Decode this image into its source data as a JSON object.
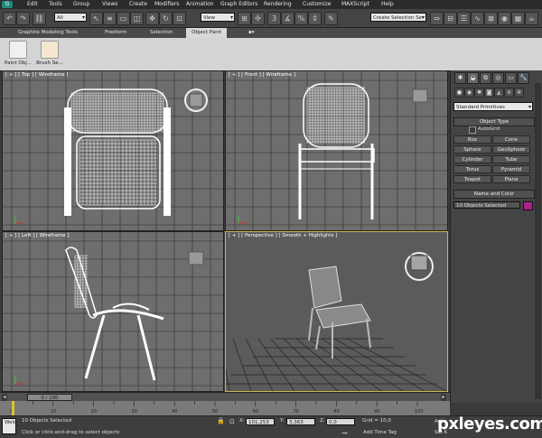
{
  "menu": [
    "Edit",
    "Tools",
    "Group",
    "Views",
    "Create",
    "Modifiers",
    "Animation",
    "Graph Editors",
    "Rendering",
    "Customize",
    "MAXScript",
    "Help"
  ],
  "toolbar": {
    "filter_value": "All",
    "view_value": "View",
    "selection_set_value": "Create Selection Se"
  },
  "ribbon": {
    "tabs": [
      "Graphite Modeling Tools",
      "Freeform",
      "Selection",
      "Object Paint"
    ],
    "active_tab": "Object Paint",
    "buttons": [
      "Paint Obj...",
      "Brush Se..."
    ]
  },
  "viewports": {
    "top": "[ + ] [ Top ] [ Wireframe ]",
    "front": "[ + ] [ Front ] [ Wireframe ]",
    "left": "[ + ] [ Left ] [ Wireframe ]",
    "perspective": "[ + ] [ Perspective ] [ Smooth + Highlights ]"
  },
  "command_panel": {
    "category": "Standard Primitives",
    "object_type_title": "Object Type",
    "autogrid_label": "AutoGrid",
    "primitives": [
      "Box",
      "Cone",
      "Sphere",
      "GeoSphere",
      "Cylinder",
      "Tube",
      "Torus",
      "Pyramid",
      "Teapot",
      "Plane"
    ],
    "name_color_title": "Name and Color",
    "name_value": "10 Objects Selected",
    "object_color": "#b0208a"
  },
  "timeline": {
    "frame_label": "0 / 100",
    "ticks": [
      "0",
      "10",
      "20",
      "30",
      "40",
      "50",
      "60",
      "70",
      "80",
      "90",
      "100"
    ]
  },
  "status": {
    "script_label": "Welc",
    "selection_info": "10 Objects Selected",
    "prompt": "Click or click-and-drag to select objects",
    "x_label": "X:",
    "x_value": "101,253",
    "y_label": "Y:",
    "y_value": "3,363",
    "z_label": "Z:",
    "z_value": "0,0",
    "grid": "Grid = 10,0",
    "add_time_tag": "Add Time Tag",
    "auto_key": "Auto",
    "set_key": "Set K"
  },
  "watermark": "pxleyes.com"
}
